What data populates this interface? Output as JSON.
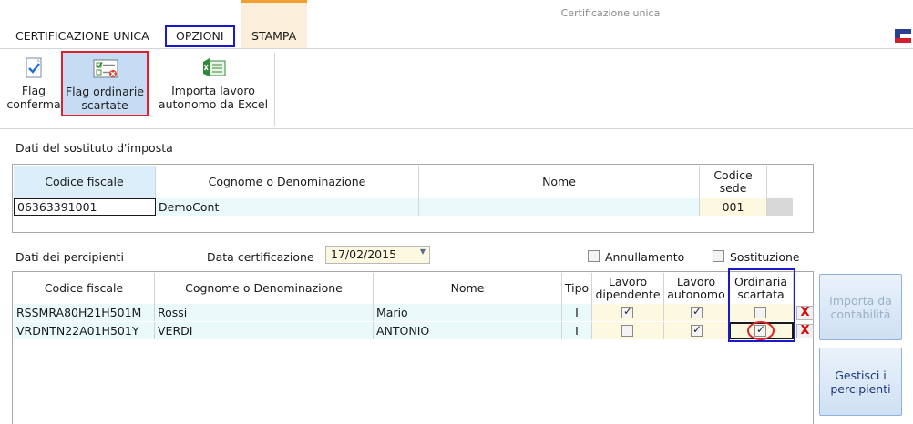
{
  "window": {
    "title": "Certificazione unica"
  },
  "tabs": [
    {
      "label": "CERTIFICAZIONE UNICA"
    },
    {
      "label": "OPZIONI"
    },
    {
      "label": "STAMPA"
    }
  ],
  "ribbon": {
    "flag_conferma": {
      "line1": "Flag",
      "line2": "conferma"
    },
    "flag_ordinarie": {
      "line1": "Flag ordinarie",
      "line2": "scartate"
    },
    "importa_excel": {
      "line1": "Importa lavoro",
      "line2": "autonomo da Excel"
    }
  },
  "sostituto": {
    "section_label": "Dati del sostituto d'imposta",
    "headers": {
      "codice_fiscale": "Codice fiscale",
      "cognome": "Cognome o Denominazione",
      "nome": "Nome",
      "codice_sede_1": "Codice",
      "codice_sede_2": "sede"
    },
    "row": {
      "codice_fiscale": "06363391001",
      "cognome": "DemoCont",
      "nome": "",
      "codice_sede": "001"
    }
  },
  "percipienti": {
    "section_label": "Dati dei percipienti",
    "data_label": "Data certificazione",
    "data_value": "17/02/2015",
    "annullamento_label": "Annullamento",
    "annullamento_checked": false,
    "sostituzione_label": "Sostituzione",
    "sostituzione_checked": false,
    "headers": {
      "codice_fiscale": "Codice fiscale",
      "cognome": "Cognome o Denominazione",
      "nome": "Nome",
      "tipo": "Tipo",
      "lav_dip_1": "Lavoro",
      "lav_dip_2": "dipendente",
      "lav_aut_1": "Lavoro",
      "lav_aut_2": "autonomo",
      "ord_1": "Ordinaria",
      "ord_2": "scartata"
    },
    "rows": [
      {
        "codice_fiscale": "RSSMRA80H21H501M",
        "cognome": "Rossi",
        "nome": "Mario",
        "tipo": "I",
        "lavoro_dipendente": true,
        "lavoro_autonomo": true,
        "ordinaria_scartata": false,
        "delete": "X"
      },
      {
        "codice_fiscale": "VRDNTN22A01H501Y",
        "cognome": "VERDI",
        "nome": "ANTONIO",
        "tipo": "I",
        "lavoro_dipendente": false,
        "lavoro_autonomo": true,
        "ordinaria_scartata": true,
        "delete": "X"
      }
    ]
  },
  "side_buttons": {
    "importa": {
      "line1": "Importa da",
      "line2": "contabilità"
    },
    "gestisci": {
      "line1": "Gestisci i",
      "line2": "percipienti"
    }
  },
  "colors": {
    "accent_tab": "#f0a030",
    "highlight_blue": "#1a1acc",
    "highlight_red": "#e0202a",
    "selected_bg": "#c6dcf4",
    "row_bg": "#eaf9f9"
  }
}
